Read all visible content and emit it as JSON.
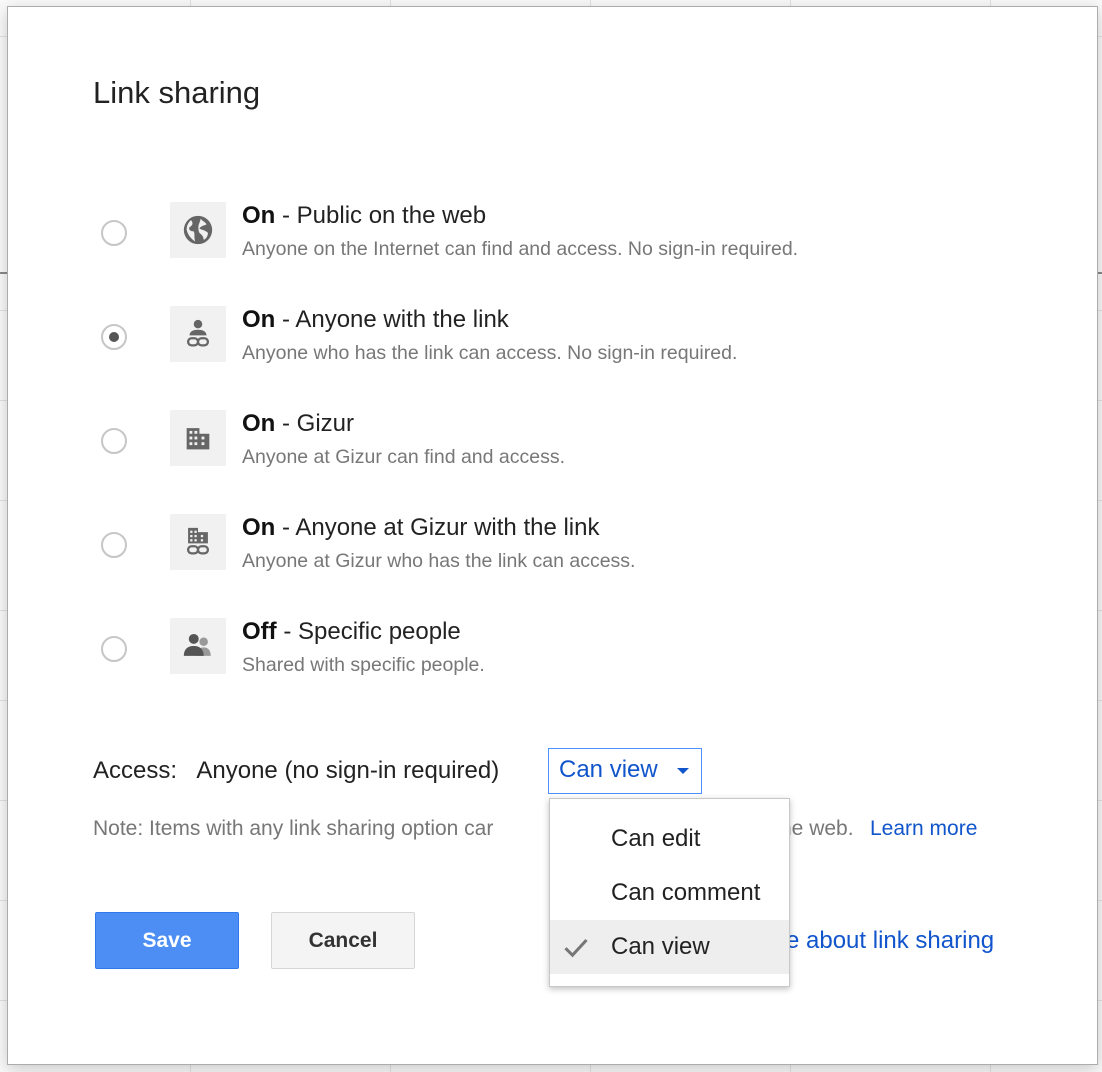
{
  "dialog": {
    "title": "Link sharing",
    "options": [
      {
        "state": "On",
        "title": " - Public on the web",
        "desc": "Anyone on the Internet can find and access. No sign-in required.",
        "icon": "globe-icon",
        "checked": false
      },
      {
        "state": "On",
        "title": " - Anyone with the link",
        "desc": "Anyone who has the link can access. No sign-in required.",
        "icon": "person-link-icon",
        "checked": true
      },
      {
        "state": "On",
        "title": " - Gizur",
        "desc": "Anyone at Gizur can find and access.",
        "icon": "building-icon",
        "checked": false
      },
      {
        "state": "On",
        "title": " - Anyone at Gizur with the link",
        "desc": "Anyone at Gizur who has the link can access.",
        "icon": "building-link-icon",
        "checked": false
      },
      {
        "state": "Off",
        "title": " - Specific people",
        "desc": "Shared with specific people.",
        "icon": "people-icon",
        "checked": false
      }
    ],
    "access": {
      "label": "Access:",
      "value": "Anyone (no sign-in required)",
      "dropdown": "Can view"
    },
    "note": {
      "text": "Note: Items with any link sharing option car",
      "cut_text": "ne web.",
      "learn_more": "Learn more"
    },
    "buttons": {
      "save": "Save",
      "cancel": "Cancel"
    },
    "learn_link": "e about link sharing",
    "menu": {
      "items": [
        {
          "label": "Can edit",
          "selected": false
        },
        {
          "label": "Can comment",
          "selected": false
        },
        {
          "label": "Can view",
          "selected": true
        }
      ]
    }
  },
  "colors": {
    "accent": "#1155cc",
    "primary_button": "#4d8ef5",
    "focus_border": "#4d90fe"
  }
}
